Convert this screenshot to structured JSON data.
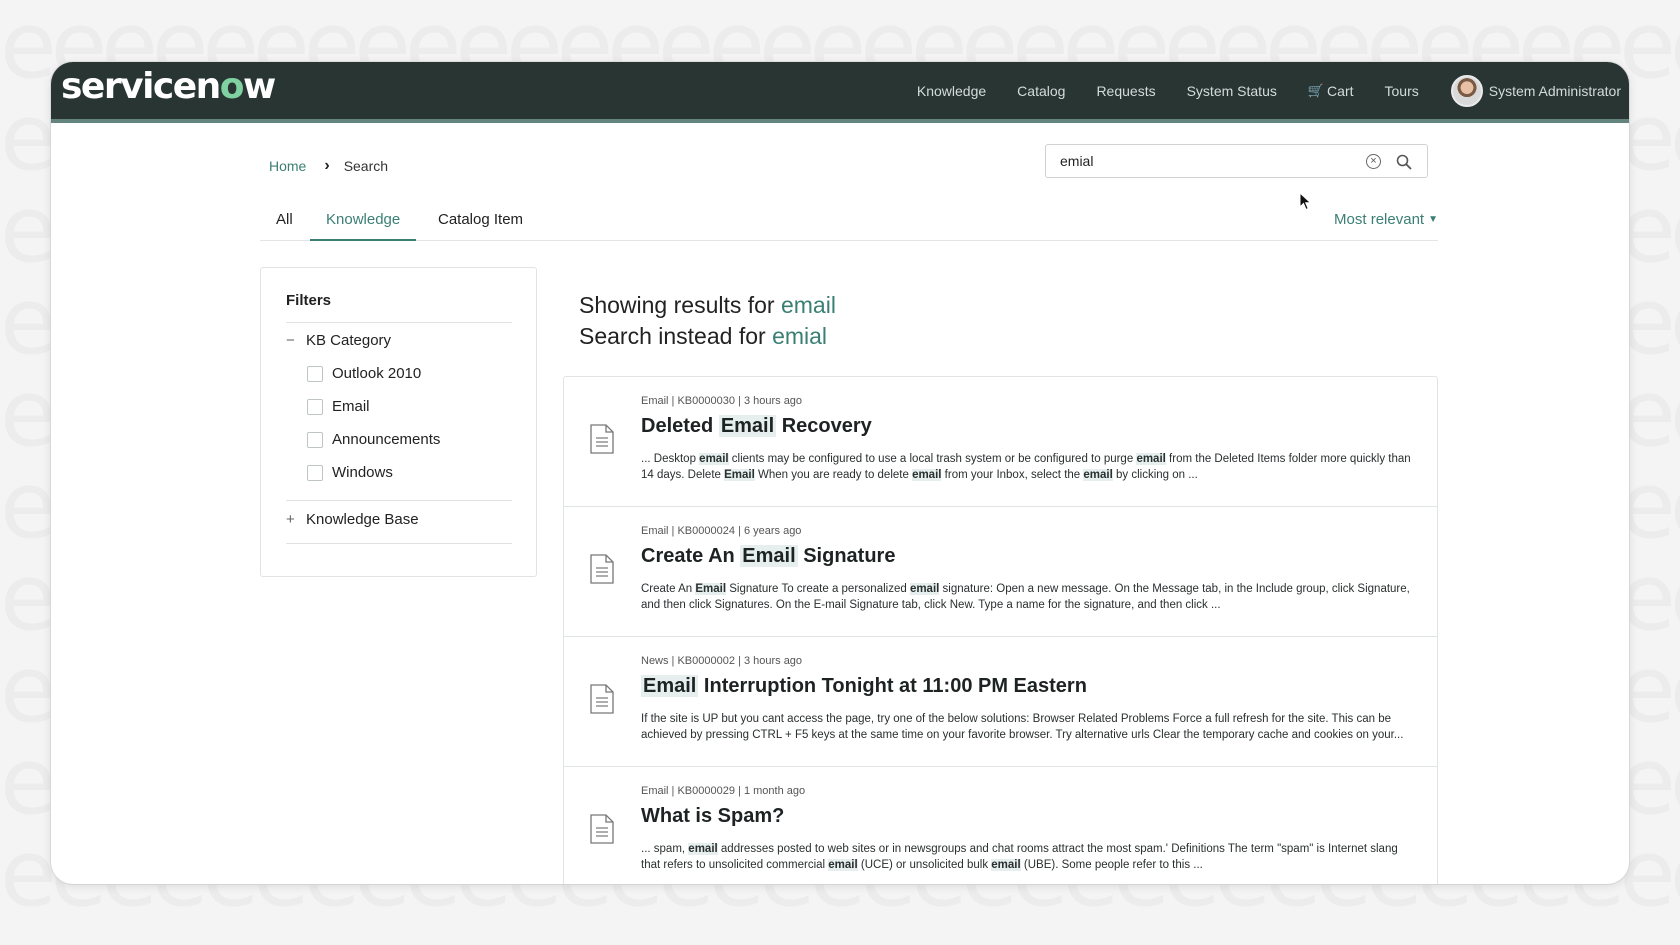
{
  "brand": {
    "logo_text": "servicenow"
  },
  "nav": {
    "items": [
      "Knowledge",
      "Catalog",
      "Requests",
      "System Status",
      "Cart",
      "Tours"
    ],
    "user_name": "System Administrator"
  },
  "breadcrumb": {
    "home": "Home",
    "current": "Search"
  },
  "search": {
    "value": "emial",
    "placeholder": ""
  },
  "tabs": [
    "All",
    "Knowledge",
    "Catalog Item"
  ],
  "active_tab": "Knowledge",
  "sort": {
    "label": "Most relevant"
  },
  "filters": {
    "title": "Filters",
    "groups": [
      {
        "label": "KB Category",
        "expanded": true,
        "options": [
          "Outlook 2010",
          "Email",
          "Announcements",
          "Windows"
        ]
      },
      {
        "label": "Knowledge Base",
        "expanded": false,
        "options": []
      }
    ]
  },
  "heading": {
    "showing_prefix": "Showing results for",
    "showing_term": "email",
    "instead_prefix": "Search instead for",
    "instead_term": "emial"
  },
  "results": [
    {
      "meta": "Email | KB0000030 | 3 hours ago",
      "title_pre": "Deleted ",
      "title_hl": "Email",
      "title_post": " Recovery",
      "snippet": "... Desktop <b>email</b> clients may be configured to use a local trash system or be configured to purge <b>email</b> from the Deleted Items folder more quickly than 14 days. Delete <b>Email</b> When you are ready to delete <b>email</b> from your Inbox, select the <b>email</b> by clicking on ..."
    },
    {
      "meta": "Email | KB0000024 | 6 years ago",
      "title_pre": "Create An ",
      "title_hl": "Email",
      "title_post": " Signature",
      "snippet": "Create An <b>Email</b> Signature To create a personalized <b>email</b> signature: Open a new message. On the Message tab, in the Include group, click Signature, and then click Signatures. On the E-mail Signature tab, click New. Type a name for the signature, and then click ..."
    },
    {
      "meta": "News | KB0000002 | 3 hours ago",
      "title_pre": "",
      "title_hl": "Email",
      "title_post": " Interruption Tonight at 11:00 PM Eastern",
      "snippet": " If the site is UP but you cant access the page, try one of the below solutions: Browser Related Problems Force a full refresh for the site. This can be achieved by pressing CTRL + F5 keys at the same time on your favorite browser. Try alternative urls Clear the temporary cache and cookies on your..."
    },
    {
      "meta": "Email | KB0000029 | 1 month ago",
      "title_pre": "What is Spam?",
      "title_hl": "",
      "title_post": "",
      "snippet": "... spam, <b>email</b> addresses posted to web sites or in newsgroups and chat rooms attract the most spam.' Definitions The term \"spam\" is Internet slang that refers to unsolicited commercial <b>email</b> (UCE) or unsolicited bulk <b>email</b> (UBE). Some people refer to this ..."
    }
  ],
  "colors": {
    "topbar": "#283533",
    "accent": "#3b7f74",
    "logo_o": "#7fd1a1"
  }
}
